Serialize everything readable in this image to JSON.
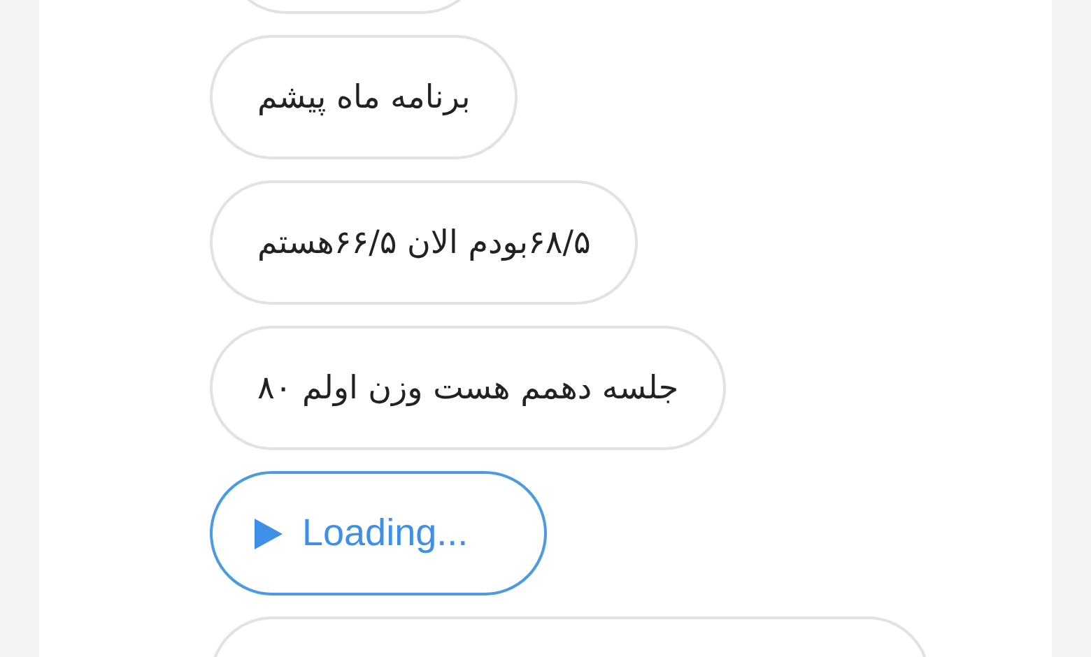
{
  "messages": [
    {
      "kind": "cut"
    },
    {
      "kind": "text",
      "text": "برنامه ماه پیشم"
    },
    {
      "kind": "text",
      "text": "۶۸/۵بودم الان ۶۶/۵هستم"
    },
    {
      "kind": "text",
      "text": "جلسه دهمم هست وزن اولم ۸۰"
    },
    {
      "kind": "voice",
      "text": "Loading..."
    },
    {
      "kind": "cut"
    }
  ]
}
